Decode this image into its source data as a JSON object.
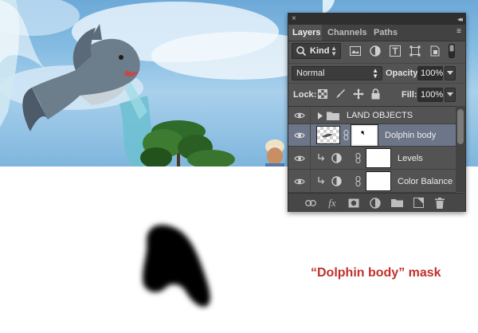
{
  "panel": {
    "close_glyph": "×",
    "collapse_glyph": "◂◂",
    "menu_glyph": "≡",
    "tabs": [
      {
        "label": "Layers",
        "active": true
      },
      {
        "label": "Channels",
        "active": false
      },
      {
        "label": "Paths",
        "active": false
      }
    ],
    "filter": {
      "kind_label": "Kind",
      "icons": [
        "image-filter-icon",
        "adjustment-filter-icon",
        "type-filter-icon",
        "shape-filter-icon",
        "smart-object-filter-icon",
        "filter-toggle-icon"
      ]
    },
    "blend": {
      "mode": "Normal",
      "opacity_label": "Opacity:",
      "opacity_value": "100%"
    },
    "lock": {
      "label": "Lock:",
      "icons": [
        "lock-transparent-pixels-icon",
        "lock-image-pixels-icon",
        "lock-position-icon",
        "lock-all-icon"
      ],
      "fill_label": "Fill:",
      "fill_value": "100%"
    },
    "layers": [
      {
        "name": "LAND OBJECTS",
        "type": "group",
        "visible": true,
        "selected": false
      },
      {
        "name": "Dolphin body",
        "type": "layer-with-mask",
        "visible": true,
        "selected": true
      },
      {
        "name": "Levels",
        "type": "adjustment",
        "visible": true,
        "selected": false
      },
      {
        "name": "Color Balance",
        "type": "adjustment",
        "visible": true,
        "selected": false
      }
    ],
    "bottom_icons": [
      "link-layers-icon",
      "fx-icon",
      "add-mask-icon",
      "new-adjustment-icon",
      "new-group-icon",
      "new-layer-icon",
      "delete-layer-icon"
    ],
    "fx_label": "fx"
  },
  "caption": {
    "text": "“Dolphin body” mask",
    "color": "#c0302b"
  },
  "colors": {
    "panel_bg": "#535353",
    "selected_row": "#6c7688",
    "sky": "#86bde3"
  }
}
